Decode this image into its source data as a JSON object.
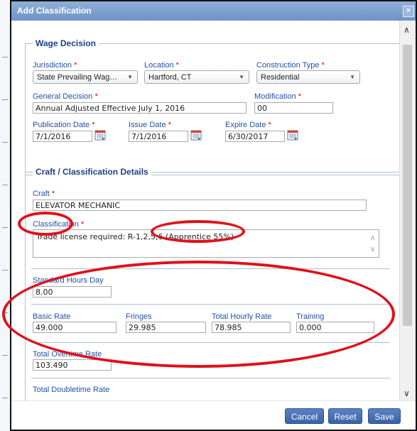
{
  "dialog": {
    "title": "Add Classification",
    "close_glyph": "×"
  },
  "wage_decision": {
    "legend": "Wage Decision",
    "jurisdiction": {
      "label": "Jurisdiction",
      "value": "State Prevailing Wag…"
    },
    "location": {
      "label": "Location",
      "value": "Hartford, CT"
    },
    "construction_type": {
      "label": "Construction Type",
      "value": "Residential"
    },
    "general_decision": {
      "label": "General Decision",
      "value": "Annual Adjusted Effective July 1, 2016"
    },
    "modification": {
      "label": "Modification",
      "value": "00"
    },
    "publication_date": {
      "label": "Publication Date",
      "value": "7/1/2016"
    },
    "issue_date": {
      "label": "Issue Date",
      "value": "7/1/2016"
    },
    "expire_date": {
      "label": "Expire Date",
      "value": "6/30/2017"
    }
  },
  "craft_details": {
    "legend": "Craft / Classification Details",
    "craft": {
      "label": "Craft",
      "value": "ELEVATOR MECHANIC"
    },
    "classification": {
      "label": "Classification",
      "value": "Trade license required: R-1,2,5,6 (Apprentice 55%)"
    },
    "standard_hours_day": {
      "label": "Standard Hours Day",
      "value": "8.00"
    },
    "basic_rate": {
      "label": "Basic Rate",
      "value": "49.000"
    },
    "fringes": {
      "label": "Fringes",
      "value": "29.985"
    },
    "total_hourly_rate": {
      "label": "Total Hourly Rate",
      "value": "78.985"
    },
    "training": {
      "label": "Training",
      "value": "0.000"
    },
    "total_overtime_rate": {
      "label": "Total Overtime Rate",
      "value": "103.490"
    },
    "total_doubletime_rate": {
      "label": "Total Doubletime Rate"
    }
  },
  "required_marker": "*",
  "select_caret": "▼",
  "scroll": {
    "up": "∧",
    "down": "∨"
  },
  "buttons": {
    "cancel": "Cancel",
    "reset": "Reset",
    "save": "Save"
  },
  "colors": {
    "label": "#2350a7",
    "legend": "#1c3f86",
    "required": "#dd0000",
    "button": "#3a62a8",
    "annotation": "#e0101a"
  },
  "icons": {
    "calendar": "calendar-icon",
    "close": "close-icon"
  }
}
